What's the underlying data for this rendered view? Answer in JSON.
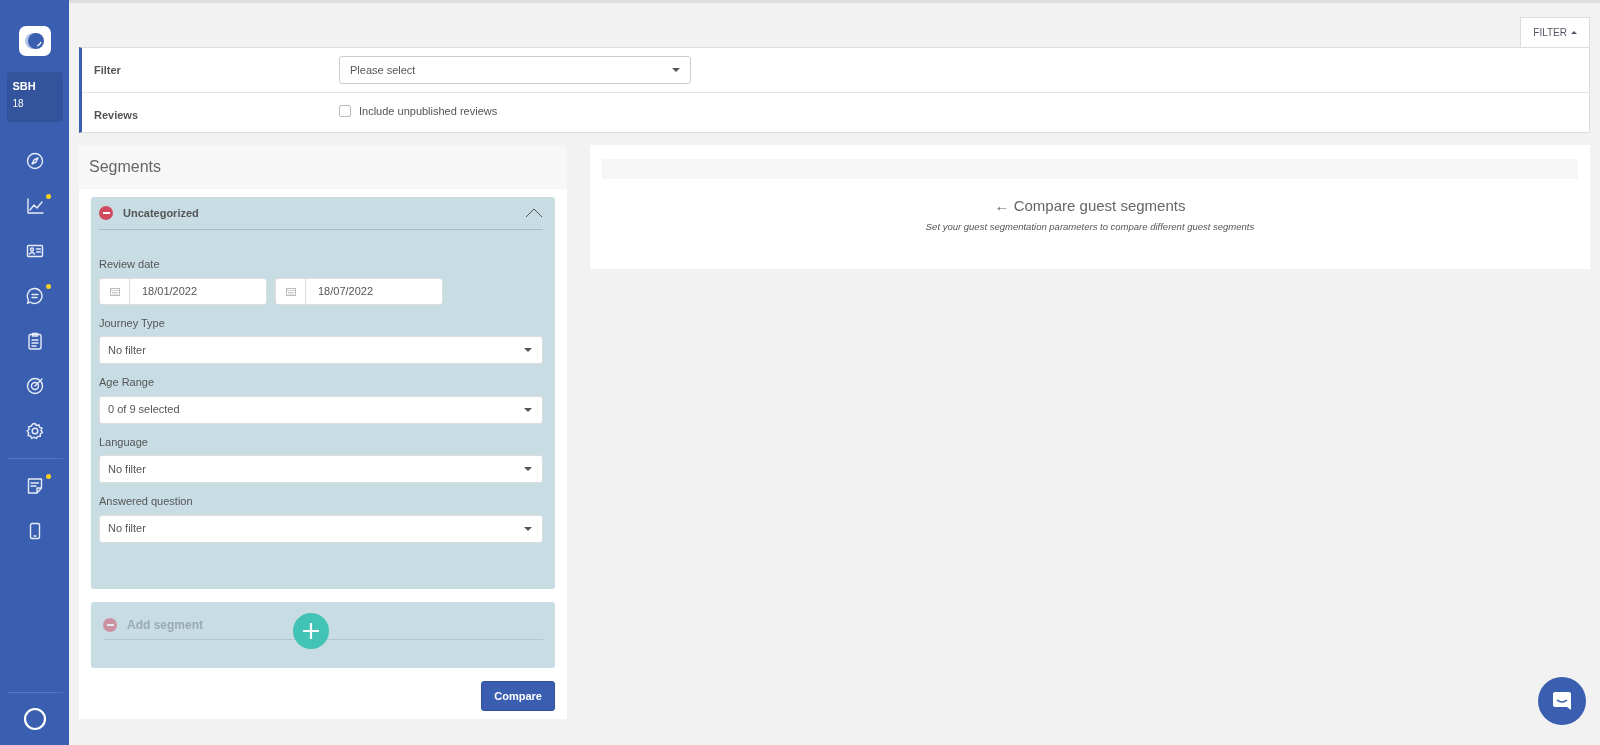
{
  "sidebar": {
    "account": {
      "name": "SBH",
      "number": "18"
    },
    "groups": [
      [
        {
          "dot": false
        },
        {
          "dot": true
        },
        {
          "dot": false
        },
        {
          "dot": true
        },
        {
          "dot": false
        },
        {
          "dot": false
        },
        {
          "dot": false
        }
      ],
      [
        {
          "dot": true
        },
        {
          "dot": false
        }
      ]
    ]
  },
  "filter_tab": {
    "label": "FILTER",
    "expanded": true
  },
  "filter_panel": {
    "rows": [
      {
        "kind": "select",
        "label": "Filter",
        "placeholder": "Please select"
      },
      {
        "kind": "checkbox",
        "label": "Reviews",
        "option": "Include unpublished reviews",
        "checked": false
      }
    ]
  },
  "segments_panel": {
    "title": "Segments",
    "segments": [
      {
        "title": "Uncategorized",
        "expanded": true,
        "fields": [
          {
            "kind": "date_range",
            "label": "Review date",
            "from": "18/01/2022",
            "to": "18/07/2022"
          },
          {
            "kind": "select",
            "label": "Journey Type",
            "value": "No filter"
          },
          {
            "kind": "select",
            "label": "Age Range",
            "value": "0 of 9 selected"
          },
          {
            "kind": "select",
            "label": "Language",
            "value": "No filter"
          },
          {
            "kind": "select",
            "label": "Answered question",
            "value": "No filter"
          }
        ]
      }
    ],
    "add_segment": {
      "label": "Add segment"
    },
    "compare_button": "Compare"
  },
  "result_panel": {
    "heading": "Compare guest segments",
    "arrow": "←",
    "subtitle": "Set your guest segmentation parameters to compare different guest segments"
  }
}
